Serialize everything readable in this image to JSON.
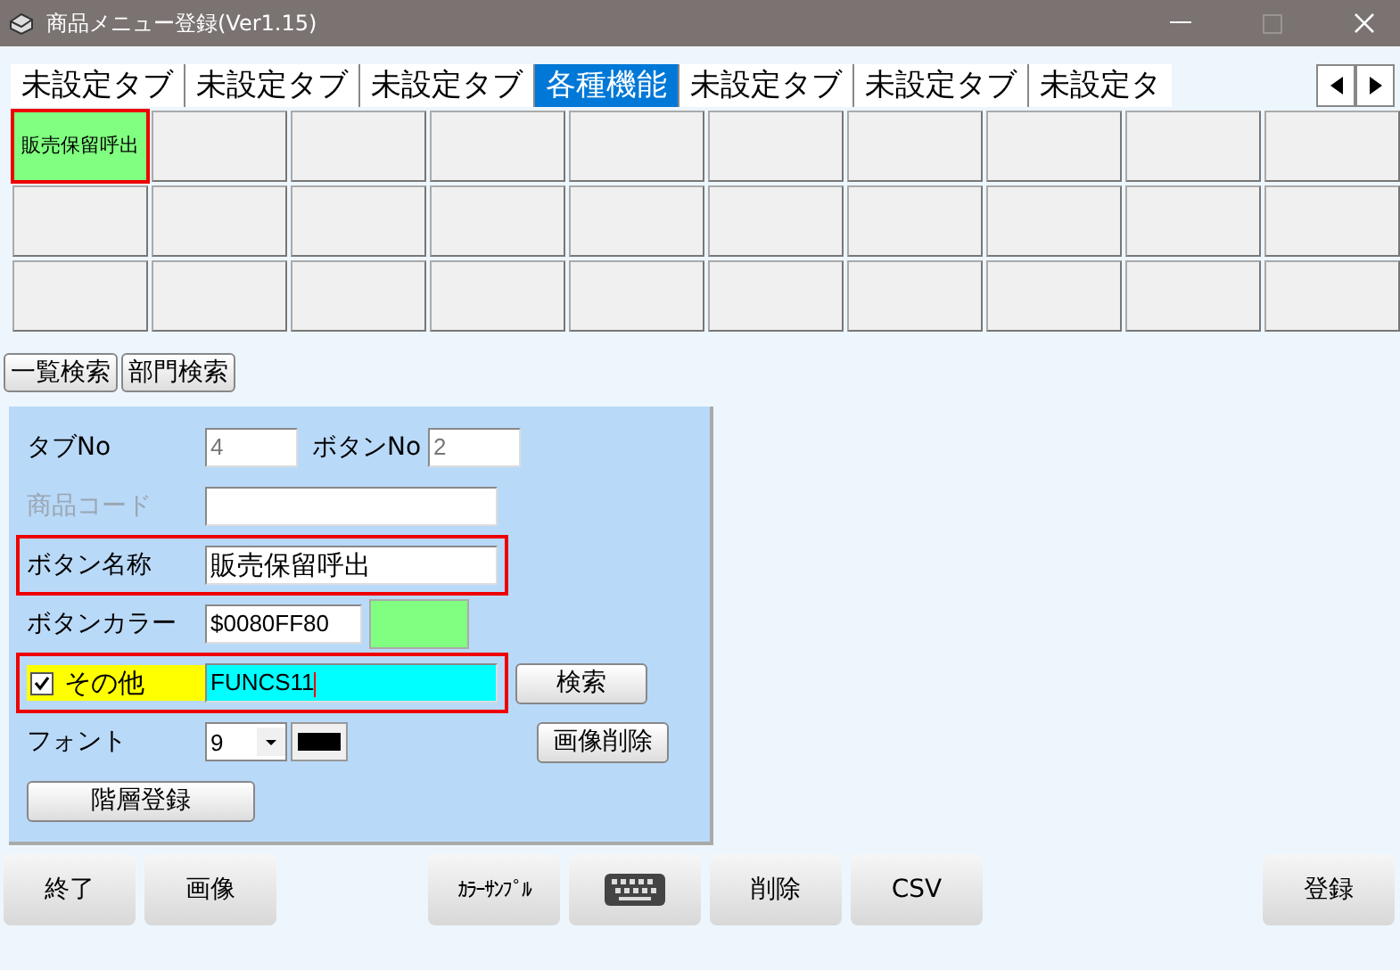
{
  "window": {
    "title": "商品メニュー登録(Ver1.15)"
  },
  "tabs": [
    {
      "label": "未設定タブ",
      "selected": false
    },
    {
      "label": "未設定タブ",
      "selected": false
    },
    {
      "label": "未設定タブ",
      "selected": false
    },
    {
      "label": "各種機能",
      "selected": true
    },
    {
      "label": "未設定タブ",
      "selected": false
    },
    {
      "label": "未設定タブ",
      "selected": false
    },
    {
      "label": "未設定タ",
      "selected": false
    }
  ],
  "menu_buttons": [
    {
      "label": "販売保留呼出",
      "color": "#80ff80",
      "selected": true
    },
    {
      "selected": false
    },
    {
      "selected": false
    },
    {
      "selected": false
    },
    {
      "selected": false
    },
    {
      "selected": false
    },
    {
      "selected": false
    },
    {
      "selected": false
    },
    {
      "selected": false
    },
    {
      "selected": false
    },
    {
      "selected": false
    },
    {
      "selected": false
    },
    {
      "selected": false
    },
    {
      "selected": false
    },
    {
      "selected": false
    },
    {
      "selected": false
    },
    {
      "selected": false
    },
    {
      "selected": false
    },
    {
      "selected": false
    },
    {
      "selected": false
    },
    {
      "selected": false
    },
    {
      "selected": false
    },
    {
      "selected": false
    },
    {
      "selected": false
    },
    {
      "selected": false
    },
    {
      "selected": false
    },
    {
      "selected": false
    },
    {
      "selected": false
    },
    {
      "selected": false
    },
    {
      "selected": false
    }
  ],
  "search_buttons": [
    "一覧検索",
    "部門検索"
  ],
  "form": {
    "tab_no": {
      "label": "タブNo",
      "value": "4"
    },
    "button_no": {
      "label": "ボタンNo",
      "value": "2"
    },
    "product_code": {
      "label": "商品コード",
      "disabled": true
    },
    "button_name": {
      "label": "ボタン名称",
      "value": "販売保留呼出",
      "highlighted": true
    },
    "button_color": {
      "label": "ボタンカラー",
      "value": "$0080FF80",
      "color": "#80ff80"
    },
    "other": {
      "label": "その他",
      "checked": true,
      "value": "FUNCS11",
      "highlighted": true,
      "search_button": "検索"
    },
    "font": {
      "label": "フォント",
      "value": "9",
      "color": "#000000",
      "delete_image_button": "画像削除"
    },
    "hierarchy_button": "階層登録"
  },
  "bottom_buttons": [
    {
      "kind": "text",
      "label": "終了"
    },
    {
      "kind": "text",
      "label": "画像"
    },
    {
      "kind": "gap"
    },
    {
      "kind": "narrow",
      "label": "ｶﾗｰｻﾝﾌﾟﾙ"
    },
    {
      "kind": "keyboard"
    },
    {
      "kind": "text",
      "label": "削除"
    },
    {
      "kind": "text",
      "label": "CSV"
    },
    {
      "kind": "spacer"
    },
    {
      "kind": "text",
      "label": "登録"
    }
  ]
}
